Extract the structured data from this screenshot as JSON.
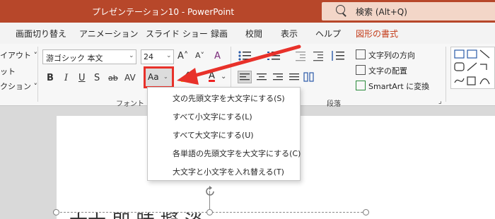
{
  "titlebar": {
    "title": "プレゼンテーション10  -  PowerPoint",
    "search_placeholder": "検索 (Alt+Q)",
    "bg_color": "#b7472a"
  },
  "tabs": [
    "画面切り替え",
    "アニメーション",
    "スライド ショー",
    "録画",
    "校閲",
    "表示",
    "ヘルプ",
    "図形の書式"
  ],
  "active_tab_color": "#c43e1c",
  "left_partial": [
    "イアウト ˅",
    "ット",
    "クション ˅"
  ],
  "font_group": {
    "font_name": "游ゴシック 本文",
    "font_size": "24",
    "grow_font": "A˄",
    "shrink_font": "A˅",
    "clear_format": "A",
    "bold": "B",
    "italic": "I",
    "underline": "U",
    "shadow": "S",
    "strikethrough": "ab",
    "char_spacing": "AV",
    "change_case": "Aa",
    "font_color": "A",
    "group_label": "フォント"
  },
  "paragraph_group": {
    "group_label": "段落",
    "text_direction": "文字列の方向",
    "align_text": "文字の配置",
    "smartart": "SmartArt に変換"
  },
  "case_menu": {
    "items": [
      "文の先頭文字を大文字にする(S)",
      "すべて小文字にする(L)",
      "すべて大文字にする(U)",
      "各単語の先頭文字を大文字にする(C)",
      "大文字と小文字を入れ替える(T)"
    ]
  },
  "slide": {
    "text_partial": "士士 即 時  擬 淡"
  },
  "highlight_color": "#e8312a"
}
